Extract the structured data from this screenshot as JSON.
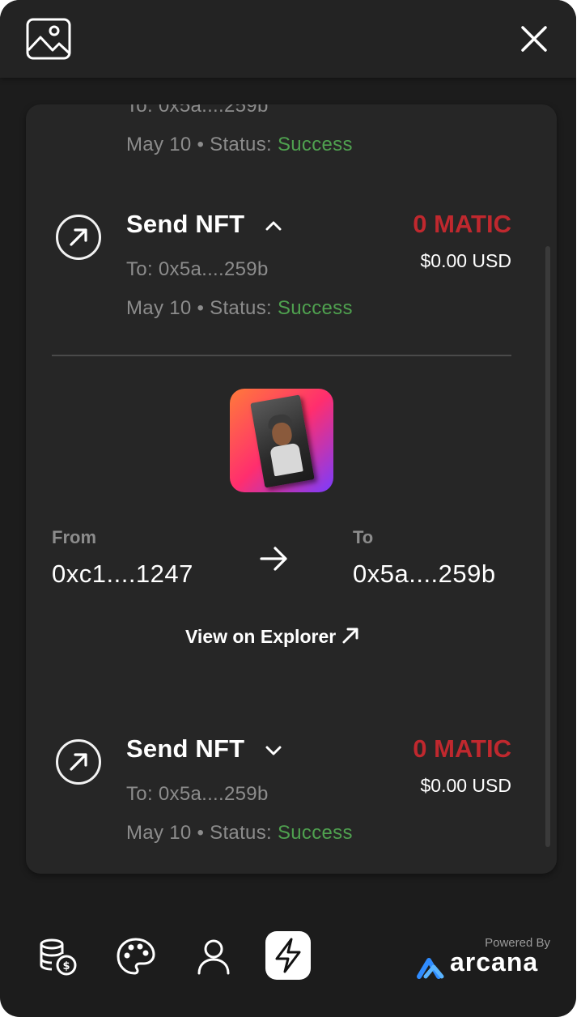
{
  "header": {
    "logo_icon": "image-icon",
    "close_icon": "close-icon"
  },
  "transactions": [
    {
      "title": "",
      "to": "To: 0x5a....259b",
      "date": "May 10",
      "status_label": "Status:",
      "status": "Success",
      "partial": true
    },
    {
      "title": "Send NFT",
      "chevron": "chevron-up-icon",
      "amount": "0 MATIC",
      "usd": "$0.00 USD",
      "to": "To: 0x5a....259b",
      "date": "May 10",
      "status_label": "Status:",
      "status": "Success",
      "expanded": true
    },
    {
      "title": "Send NFT",
      "chevron": "chevron-down-icon",
      "amount": "0 MATIC",
      "usd": "$0.00 USD",
      "to": "To: 0x5a....259b",
      "date": "May 10",
      "status_label": "Status:",
      "status": "Success"
    }
  ],
  "details": {
    "from_label": "From",
    "from_address": "0xc1....1247",
    "to_label": "To",
    "to_address": "0x5a....259b",
    "explorer_label": "View on Explorer"
  },
  "footer": {
    "nav": [
      "tokens-icon",
      "palette-icon",
      "profile-icon",
      "activity-icon"
    ],
    "active": "activity-icon",
    "powered_by": "Powered By",
    "brand": "arcana"
  },
  "colors": {
    "amount": "#c0282e",
    "success": "#4fa14f",
    "background": "#1c1c1c",
    "card": "#262626"
  }
}
